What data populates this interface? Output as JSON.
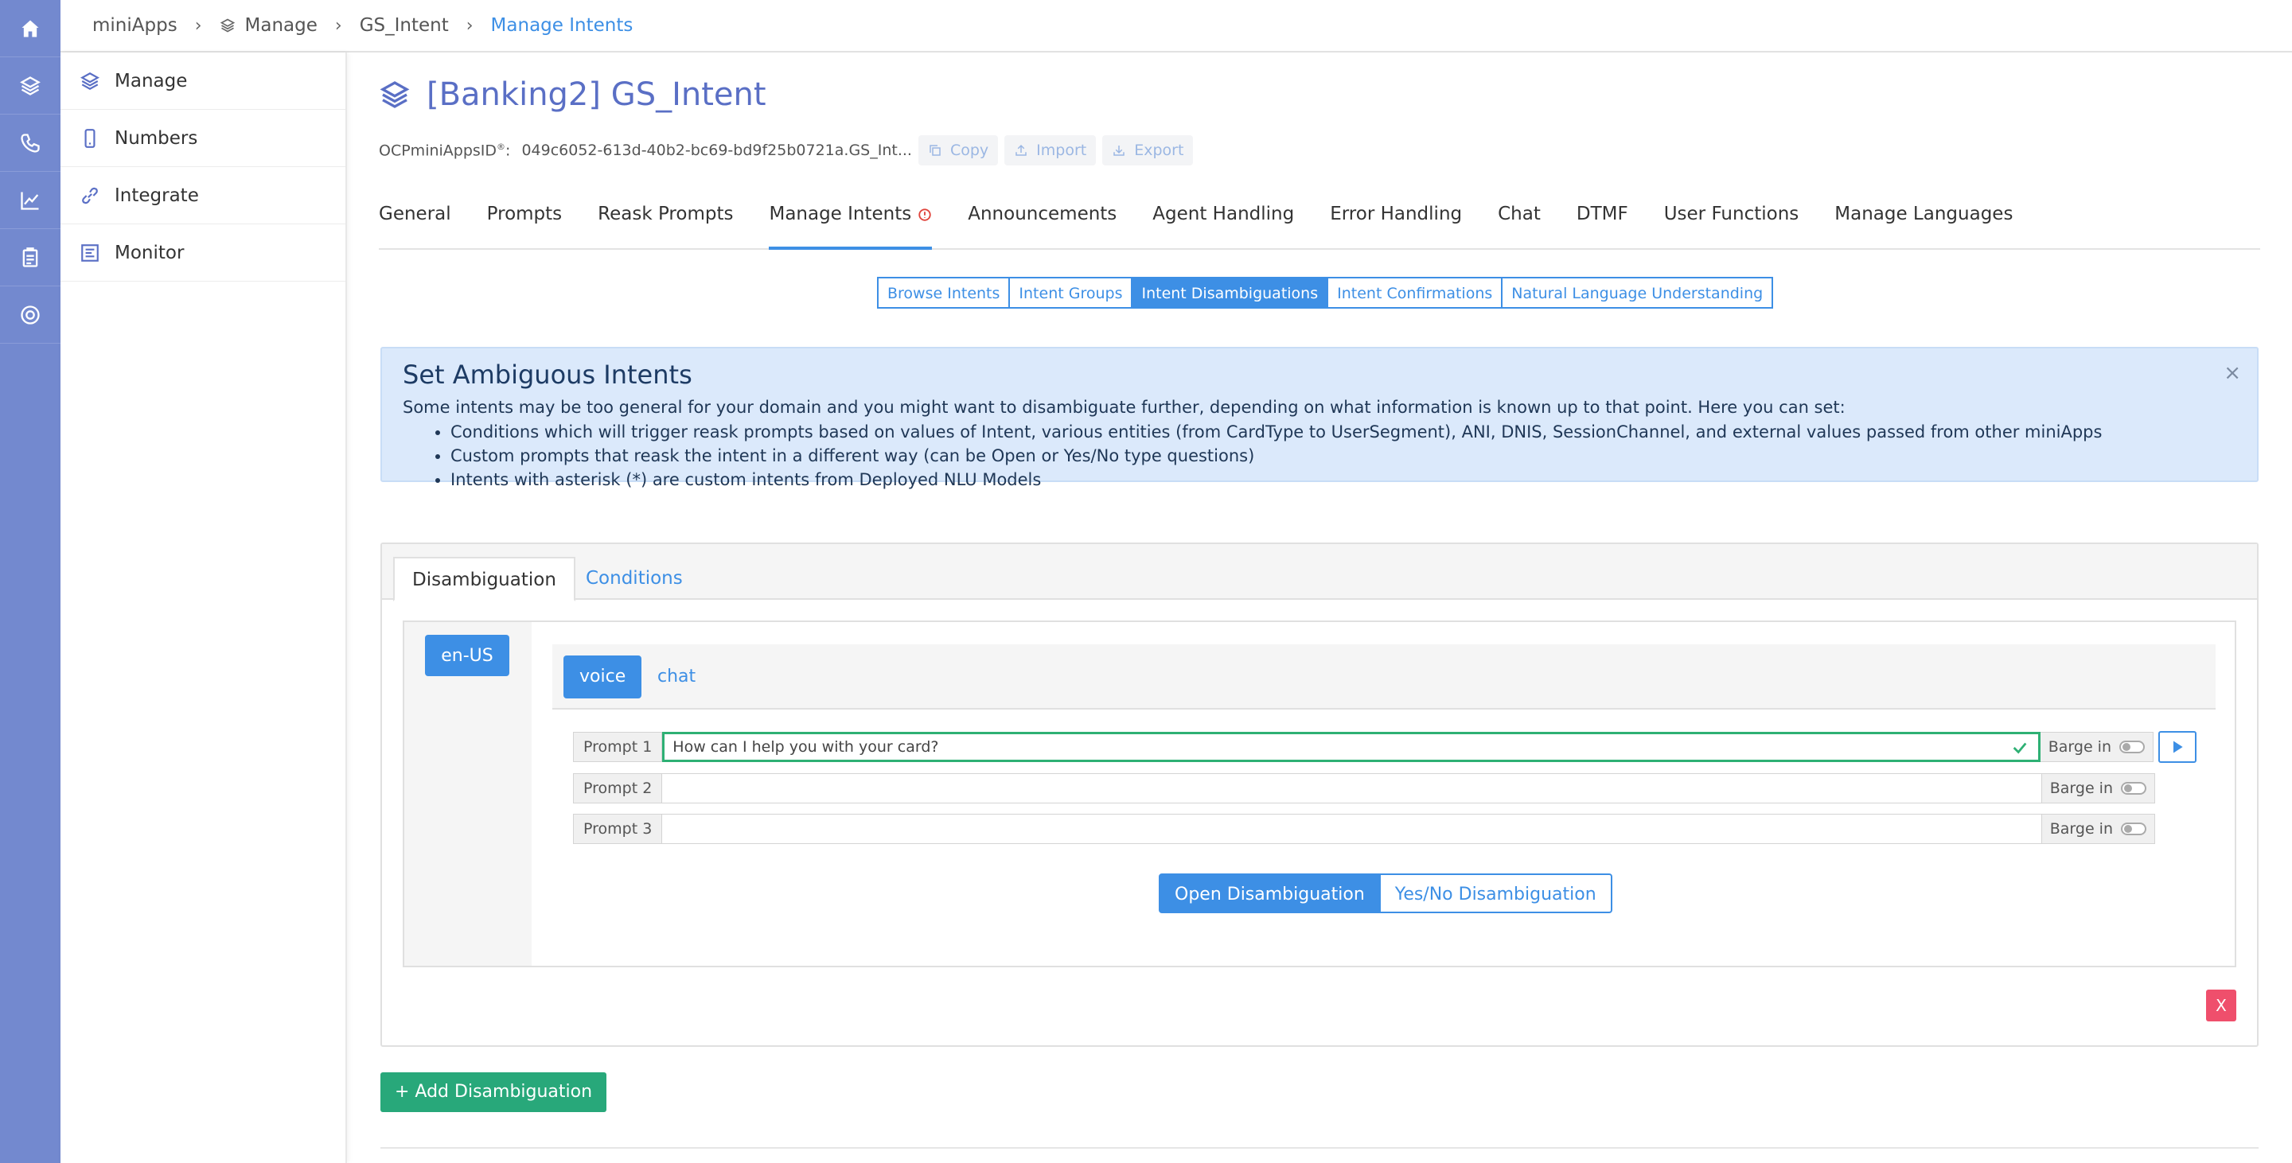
{
  "rail": {
    "items": [
      {
        "icon": "home-icon"
      },
      {
        "icon": "layers-icon"
      },
      {
        "icon": "phone-icon"
      },
      {
        "icon": "chart-icon"
      },
      {
        "icon": "clipboard-icon"
      },
      {
        "icon": "lifebuoy-icon"
      }
    ]
  },
  "breadcrumb": {
    "items": [
      "miniApps",
      "Manage",
      "GS_Intent",
      "Manage Intents"
    ]
  },
  "sidebar": {
    "items": [
      {
        "label": "Manage",
        "icon": "layers-icon"
      },
      {
        "label": "Numbers",
        "icon": "mobile-icon"
      },
      {
        "label": "Integrate",
        "icon": "link-icon"
      },
      {
        "label": "Monitor",
        "icon": "monitor-icon"
      }
    ]
  },
  "header": {
    "title": "[Banking2] GS_Intent",
    "id_label": "OCPminiAppsID",
    "id_sup": "®",
    "id_suffix": ":",
    "id_value": "049c6052-613d-40b2-bc69-bd9f25b0721a.GS_Int...",
    "copy": "Copy",
    "import": "Import",
    "export": "Export"
  },
  "tabs": [
    "General",
    "Prompts",
    "Reask Prompts",
    "Manage Intents",
    "Announcements",
    "Agent Handling",
    "Error Handling",
    "Chat",
    "DTMF",
    "User Functions",
    "Manage Languages"
  ],
  "active_tab": "Manage Intents",
  "subtabs": [
    "Browse Intents",
    "Intent Groups",
    "Intent Disambiguations",
    "Intent Confirmations",
    "Natural Language Understanding"
  ],
  "active_subtab": "Intent Disambiguations",
  "info": {
    "title": "Set Ambiguous Intents",
    "intro": "Some intents may be too general for your domain and you might want to disambiguate further, depending on what information is known up to that point. Here you can set:",
    "bullets": [
      "Conditions which will trigger reask prompts based on values of Intent, various entities (from CardType to UserSegment), ANI, DNIS, SessionChannel, and external values passed from other miniApps",
      "Custom prompts that reask the intent in a different way (can be Open or Yes/No type questions)",
      "Intents with asterisk (*) are custom intents from Deployed NLU Models"
    ],
    "close": "×"
  },
  "panel": {
    "tabs": [
      "Disambiguation",
      "Conditions"
    ],
    "language": "en-US",
    "channels": [
      "voice",
      "chat"
    ],
    "prompts": [
      {
        "label": "Prompt 1",
        "value": "How can I help you with your card?",
        "barge": "Barge in"
      },
      {
        "label": "Prompt 2",
        "value": "",
        "barge": "Barge in"
      },
      {
        "label": "Prompt 3",
        "value": "",
        "barge": "Barge in"
      }
    ],
    "open_btn": "Open Disambiguation",
    "yesno_btn": "Yes/No Disambiguation",
    "remove": "X"
  },
  "add_button": "+ Add Disambiguation",
  "colors": {
    "accent": "#3d8fe5",
    "rail": "#7389cf",
    "success": "#28a87a",
    "danger": "#ef4f6c"
  }
}
